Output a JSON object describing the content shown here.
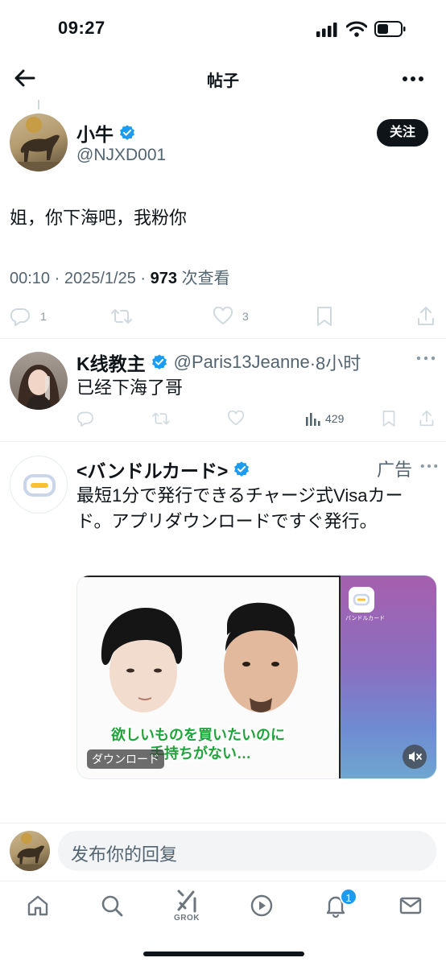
{
  "status": {
    "time": "09:27"
  },
  "header": {
    "title": "帖子"
  },
  "post": {
    "author_name": "小牛",
    "handle": "@NJXD001",
    "follow_label": "关注",
    "text": "姐，你下海吧，我粉你",
    "time": "00:10",
    "date": "2025/1/25",
    "separator": "·",
    "views_count": "973",
    "views_label": "次查看",
    "reply_count": "1",
    "like_count": "3"
  },
  "reply": {
    "author_name": "K线教主",
    "handle": "@Paris13Jeanne",
    "time": "·8小时",
    "text": "已经下海了哥",
    "views": "429"
  },
  "ad": {
    "author_name": "<バンドルカード>",
    "ad_label": "广告",
    "text": "最短1分で発行できるチャージ式Visaカード。アプリダウンロードですぐ発行。",
    "subtitle_line1": "欲しいものを買いたいのに",
    "subtitle_line2": "手持ちがない…",
    "download_label": "ダウンロード",
    "phone_app_label": "バンドルカード"
  },
  "composer": {
    "placeholder": "发布你的回复"
  },
  "tabbar": {
    "grok_label": "GROK",
    "notification_badge": "1"
  },
  "colors": {
    "verified": "#1d9bf0",
    "primary_text": "#0f1419",
    "muted": "#8b98a5",
    "badge": "#1d9bf0"
  }
}
